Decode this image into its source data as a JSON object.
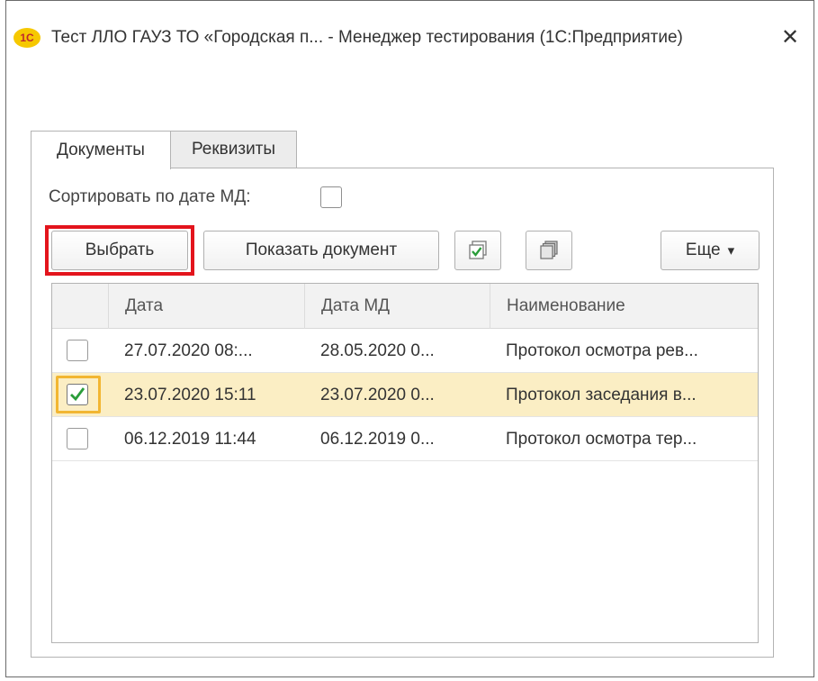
{
  "window": {
    "logo_text": "1С",
    "title": "Тест ЛЛО ГАУЗ ТО «Городская п... - Менеджер тестирования (1С:Предприятие)",
    "close_glyph": "✕"
  },
  "tabs": [
    {
      "label": "Документы",
      "active": true
    },
    {
      "label": "Реквизиты",
      "active": false
    }
  ],
  "sort": {
    "label": "Сортировать по дате МД:",
    "checked": false
  },
  "toolbar": {
    "select_label": "Выбрать",
    "show_document_label": "Показать документ",
    "check_all_icon": "check-all-icon",
    "uncheck_all_icon": "uncheck-all-icon",
    "more_label": "Еще",
    "more_glyph": "▾"
  },
  "table": {
    "columns": [
      "Дата",
      "Дата МД",
      "Наименование"
    ],
    "rows": [
      {
        "checked": false,
        "selected": false,
        "date": "27.07.2020 08:...",
        "date_md": "28.05.2020 0...",
        "name": "Протокол осмотра рев..."
      },
      {
        "checked": true,
        "selected": true,
        "date": "23.07.2020 15:11",
        "date_md": "23.07.2020 0...",
        "name": "Протокол заседания в..."
      },
      {
        "checked": false,
        "selected": false,
        "date": "06.12.2019 11:44",
        "date_md": "06.12.2019 0...",
        "name": "Протокол осмотра тер..."
      }
    ]
  },
  "colors": {
    "highlight": "#e3141c",
    "selected_row": "#fbeec4",
    "check_green": "#2a9d3a"
  }
}
